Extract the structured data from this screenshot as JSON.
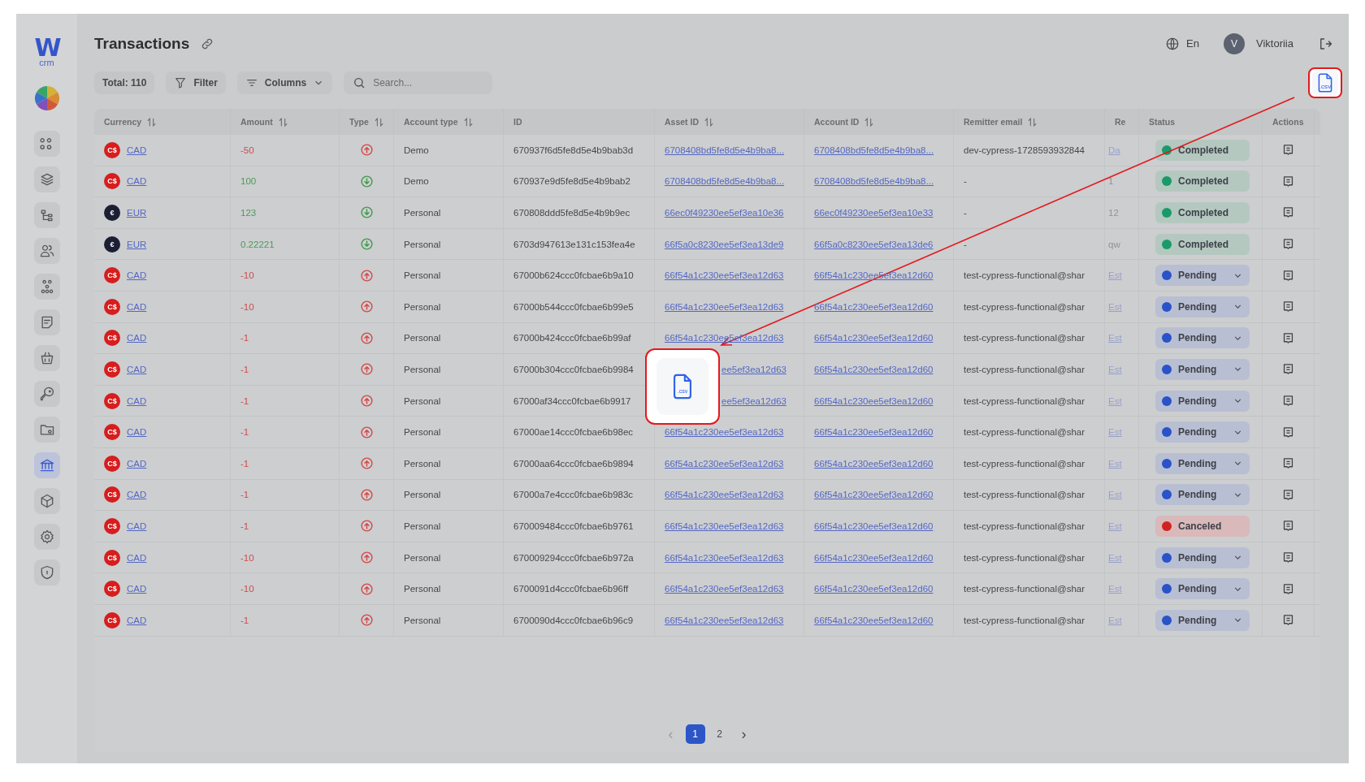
{
  "sidebar": {
    "logo": {
      "mark": "W",
      "text": "crm"
    },
    "items": [
      {
        "kind": "grid",
        "selected": false
      },
      {
        "kind": "layers",
        "selected": false
      },
      {
        "kind": "tree",
        "selected": false
      },
      {
        "kind": "users",
        "selected": false
      },
      {
        "kind": "group",
        "selected": false
      },
      {
        "kind": "note",
        "selected": false
      },
      {
        "kind": "basket",
        "selected": false
      },
      {
        "kind": "key",
        "selected": false
      },
      {
        "kind": "folder",
        "selected": false
      },
      {
        "kind": "bank",
        "selected": true
      },
      {
        "kind": "box",
        "selected": false
      },
      {
        "kind": "gear",
        "selected": false
      },
      {
        "kind": "shield",
        "selected": false
      }
    ]
  },
  "header": {
    "title": "Transactions",
    "language": "En",
    "user": {
      "initial": "V",
      "name": "Viktoriia"
    }
  },
  "toolbar": {
    "total": "Total: 110",
    "filter": "Filter",
    "columns": "Columns",
    "search": {
      "placeholder": "Search..."
    },
    "export_icon_label": ".csv"
  },
  "table": {
    "columns": [
      {
        "label": "Currency",
        "sortable": true
      },
      {
        "label": "Amount",
        "sortable": true
      },
      {
        "label": "Type",
        "sortable": true
      },
      {
        "label": "Account type",
        "sortable": true
      },
      {
        "label": "ID",
        "sortable": false
      },
      {
        "label": "Asset ID",
        "sortable": true
      },
      {
        "label": "Account ID",
        "sortable": true
      },
      {
        "label": "Remitter email",
        "sortable": true
      },
      {
        "label": "Re",
        "sortable": false
      },
      {
        "label": "Status",
        "sortable": false
      },
      {
        "label": "Actions",
        "sortable": false
      }
    ],
    "rows": [
      {
        "currency": {
          "kind": "cad",
          "symbol": "C$",
          "code": "CAD"
        },
        "amount": "-50",
        "kind": "out",
        "account_type": "Demo",
        "id": "670937f6d5fe8d5e4b9bab3d",
        "asset_id": "6708408bd5fe8d5e4b9ba8...",
        "covered": false,
        "account_id": "6708408bd5fe8d5e4b9ba8...",
        "remitter_email": "dev-cypress-1728593932844",
        "rem": {
          "text": "Da",
          "link": true
        },
        "status": {
          "kind": "completed",
          "label": "Completed"
        }
      },
      {
        "currency": {
          "kind": "cad",
          "symbol": "C$",
          "code": "CAD"
        },
        "amount": "100",
        "kind": "in",
        "account_type": "Demo",
        "id": "670937e9d5fe8d5e4b9bab2",
        "asset_id": "6708408bd5fe8d5e4b9ba8...",
        "covered": false,
        "account_id": "6708408bd5fe8d5e4b9ba8...",
        "remitter_email": "-",
        "rem": {
          "text": "1",
          "link": false
        },
        "status": {
          "kind": "completed",
          "label": "Completed"
        }
      },
      {
        "currency": {
          "kind": "eur",
          "symbol": "€",
          "code": "EUR"
        },
        "amount": "123",
        "kind": "in",
        "account_type": "Personal",
        "id": "670808ddd5fe8d5e4b9b9ec",
        "asset_id": "66ec0f49230ee5ef3ea10e36",
        "covered": false,
        "account_id": "66ec0f49230ee5ef3ea10e33",
        "remitter_email": "-",
        "rem": {
          "text": "12",
          "link": false
        },
        "status": {
          "kind": "completed",
          "label": "Completed"
        }
      },
      {
        "currency": {
          "kind": "eur",
          "symbol": "€",
          "code": "EUR"
        },
        "amount": "0.22221",
        "kind": "in",
        "account_type": "Personal",
        "id": "6703d947613e131c153fea4e",
        "asset_id": "66f5a0c8230ee5ef3ea13de9",
        "covered": false,
        "account_id": "66f5a0c8230ee5ef3ea13de6",
        "remitter_email": "-",
        "rem": {
          "text": "qw",
          "link": false
        },
        "status": {
          "kind": "completed",
          "label": "Completed"
        }
      },
      {
        "currency": {
          "kind": "cad",
          "symbol": "C$",
          "code": "CAD"
        },
        "amount": "-10",
        "kind": "out",
        "account_type": "Personal",
        "id": "67000b624ccc0fcbae6b9a10",
        "asset_id": "66f54a1c230ee5ef3ea12d63",
        "covered": false,
        "account_id": "66f54a1c230ee5ef3ea12d60",
        "remitter_email": "test-cypress-functional@shar",
        "rem": {
          "text": "Est",
          "link": true
        },
        "status": {
          "kind": "pending",
          "label": "Pending"
        }
      },
      {
        "currency": {
          "kind": "cad",
          "symbol": "C$",
          "code": "CAD"
        },
        "amount": "-10",
        "kind": "out",
        "account_type": "Personal",
        "id": "67000b544ccc0fcbae6b99e5",
        "asset_id": "66f54a1c230ee5ef3ea12d63",
        "covered": false,
        "account_id": "66f54a1c230ee5ef3ea12d60",
        "remitter_email": "test-cypress-functional@shar",
        "rem": {
          "text": "Est",
          "link": true
        },
        "status": {
          "kind": "pending",
          "label": "Pending"
        }
      },
      {
        "currency": {
          "kind": "cad",
          "symbol": "C$",
          "code": "CAD"
        },
        "amount": "-1",
        "kind": "out",
        "account_type": "Personal",
        "id": "67000b424ccc0fcbae6b99af",
        "asset_id": "66f54a1c230ee5ef3ea12d63",
        "covered": false,
        "account_id": "66f54a1c230ee5ef3ea12d60",
        "remitter_email": "test-cypress-functional@shar",
        "rem": {
          "text": "Est",
          "link": true
        },
        "status": {
          "kind": "pending",
          "label": "Pending"
        }
      },
      {
        "currency": {
          "kind": "cad",
          "symbol": "C$",
          "code": "CAD"
        },
        "amount": "-1",
        "kind": "out",
        "account_type": "Personal",
        "id": "67000b304ccc0fcbae6b9984",
        "asset_id": "ee5ef3ea12d63",
        "covered": true,
        "account_id": "66f54a1c230ee5ef3ea12d60",
        "remitter_email": "test-cypress-functional@shar",
        "rem": {
          "text": "Est",
          "link": true
        },
        "status": {
          "kind": "pending",
          "label": "Pending"
        }
      },
      {
        "currency": {
          "kind": "cad",
          "symbol": "C$",
          "code": "CAD"
        },
        "amount": "-1",
        "kind": "out",
        "account_type": "Personal",
        "id": "67000af34ccc0fcbae6b9917",
        "asset_id": "ee5ef3ea12d63",
        "covered": true,
        "account_id": "66f54a1c230ee5ef3ea12d60",
        "remitter_email": "test-cypress-functional@shar",
        "rem": {
          "text": "Est",
          "link": true
        },
        "status": {
          "kind": "pending",
          "label": "Pending"
        }
      },
      {
        "currency": {
          "kind": "cad",
          "symbol": "C$",
          "code": "CAD"
        },
        "amount": "-1",
        "kind": "out",
        "account_type": "Personal",
        "id": "67000ae14ccc0fcbae6b98ec",
        "asset_id": "66f54a1c230ee5ef3ea12d63",
        "covered": false,
        "account_id": "66f54a1c230ee5ef3ea12d60",
        "remitter_email": "test-cypress-functional@shar",
        "rem": {
          "text": "Est",
          "link": true
        },
        "status": {
          "kind": "pending",
          "label": "Pending"
        }
      },
      {
        "currency": {
          "kind": "cad",
          "symbol": "C$",
          "code": "CAD"
        },
        "amount": "-1",
        "kind": "out",
        "account_type": "Personal",
        "id": "67000aa64ccc0fcbae6b9894",
        "asset_id": "66f54a1c230ee5ef3ea12d63",
        "covered": false,
        "account_id": "66f54a1c230ee5ef3ea12d60",
        "remitter_email": "test-cypress-functional@shar",
        "rem": {
          "text": "Est",
          "link": true
        },
        "status": {
          "kind": "pending",
          "label": "Pending"
        }
      },
      {
        "currency": {
          "kind": "cad",
          "symbol": "C$",
          "code": "CAD"
        },
        "amount": "-1",
        "kind": "out",
        "account_type": "Personal",
        "id": "67000a7e4ccc0fcbae6b983c",
        "asset_id": "66f54a1c230ee5ef3ea12d63",
        "covered": false,
        "account_id": "66f54a1c230ee5ef3ea12d60",
        "remitter_email": "test-cypress-functional@shar",
        "rem": {
          "text": "Est",
          "link": true
        },
        "status": {
          "kind": "pending",
          "label": "Pending"
        }
      },
      {
        "currency": {
          "kind": "cad",
          "symbol": "C$",
          "code": "CAD"
        },
        "amount": "-1",
        "kind": "out",
        "account_type": "Personal",
        "id": "670009484ccc0fcbae6b9761",
        "asset_id": "66f54a1c230ee5ef3ea12d63",
        "covered": false,
        "account_id": "66f54a1c230ee5ef3ea12d60",
        "remitter_email": "test-cypress-functional@shar",
        "rem": {
          "text": "Est",
          "link": true
        },
        "status": {
          "kind": "canceled",
          "label": "Canceled"
        }
      },
      {
        "currency": {
          "kind": "cad",
          "symbol": "C$",
          "code": "CAD"
        },
        "amount": "-10",
        "kind": "out",
        "account_type": "Personal",
        "id": "670009294ccc0fcbae6b972a",
        "asset_id": "66f54a1c230ee5ef3ea12d63",
        "covered": false,
        "account_id": "66f54a1c230ee5ef3ea12d60",
        "remitter_email": "test-cypress-functional@shar",
        "rem": {
          "text": "Est",
          "link": true
        },
        "status": {
          "kind": "pending",
          "label": "Pending"
        }
      },
      {
        "currency": {
          "kind": "cad",
          "symbol": "C$",
          "code": "CAD"
        },
        "amount": "-10",
        "kind": "out",
        "account_type": "Personal",
        "id": "6700091d4ccc0fcbae6b96ff",
        "asset_id": "66f54a1c230ee5ef3ea12d63",
        "covered": false,
        "account_id": "66f54a1c230ee5ef3ea12d60",
        "remitter_email": "test-cypress-functional@shar",
        "rem": {
          "text": "Est",
          "link": true
        },
        "status": {
          "kind": "pending",
          "label": "Pending"
        }
      },
      {
        "currency": {
          "kind": "cad",
          "symbol": "C$",
          "code": "CAD"
        },
        "amount": "-1",
        "kind": "out",
        "account_type": "Personal",
        "id": "6700090d4ccc0fcbae6b96c9",
        "asset_id": "66f54a1c230ee5ef3ea12d63",
        "covered": false,
        "account_id": "66f54a1c230ee5ef3ea12d60",
        "remitter_email": "test-cypress-functional@shar",
        "rem": {
          "text": "Est",
          "link": true
        },
        "status": {
          "kind": "pending",
          "label": "Pending"
        }
      }
    ]
  },
  "pagination": {
    "prev": "‹",
    "prev_disabled": true,
    "pages": [
      {
        "label": "1",
        "selected": true
      },
      {
        "label": "2",
        "selected": false
      }
    ],
    "next": "›"
  },
  "annotation": {
    "callout_icon_label": ".csv"
  }
}
